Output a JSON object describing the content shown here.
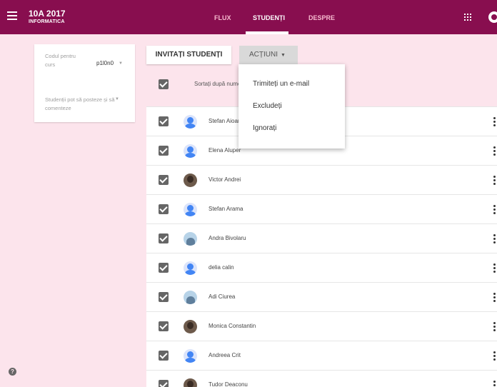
{
  "header": {
    "class_name": "10A 2017",
    "class_section": "INFORMATICA",
    "tabs": [
      {
        "label": "FLUX"
      },
      {
        "label": "STUDENȚI"
      },
      {
        "label": "DESPRE"
      }
    ],
    "brand_color": "#880e4f"
  },
  "settings_card": {
    "code_label": "Codul pentru curs",
    "code_value": "p1l0n0",
    "permissions_text": "Studenții pot să posteze și să comenteze"
  },
  "toolbar": {
    "invite_label": "INVITAȚI STUDENȚI",
    "actions_label": "ACȚIUNI"
  },
  "sort": {
    "label": "Sortați după nume"
  },
  "actions_menu": {
    "items": [
      {
        "label": "Trimiteți un e-mail"
      },
      {
        "label": "Excludeți"
      },
      {
        "label": "Ignorați"
      }
    ]
  },
  "students": [
    {
      "name": "Stefan Aioanei",
      "avatar": "default"
    },
    {
      "name": "Elena Aluper",
      "avatar": "default"
    },
    {
      "name": "Victor Andrei",
      "avatar": "photo"
    },
    {
      "name": "Stefan Arama",
      "avatar": "default"
    },
    {
      "name": "Andra Bivolaru",
      "avatar": "photo2"
    },
    {
      "name": "delia calin",
      "avatar": "default"
    },
    {
      "name": "Adi Ciurea",
      "avatar": "photo2"
    },
    {
      "name": "Monica Constantin",
      "avatar": "photo"
    },
    {
      "name": "Andreea Crit",
      "avatar": "default"
    },
    {
      "name": "Tudor Deaconu",
      "avatar": "photo"
    }
  ]
}
